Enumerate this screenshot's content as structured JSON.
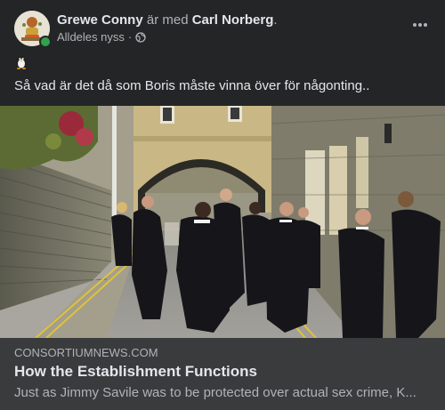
{
  "post": {
    "author_name": "Grewe Conny",
    "with_text": "är med",
    "tagged_name": "Carl Norberg",
    "timestamp": "Alldeles nyss",
    "separator": "·",
    "privacy_icon": "globe-icon",
    "emoji": "penguin",
    "text": "Så vad är det då som Boris  måste vinna över för någonting.."
  },
  "link_preview": {
    "domain": "CONSORTIUMNEWS.COM",
    "title": "How the Establishment Functions",
    "description": "Just as Jimmy Savile was to be protected over actual sex crime, K..."
  },
  "colors": {
    "background": "#242526",
    "link_box": "#3a3b3c",
    "primary_text": "#e4e6eb",
    "secondary_text": "#b0b3b8",
    "online": "#31a24c"
  }
}
